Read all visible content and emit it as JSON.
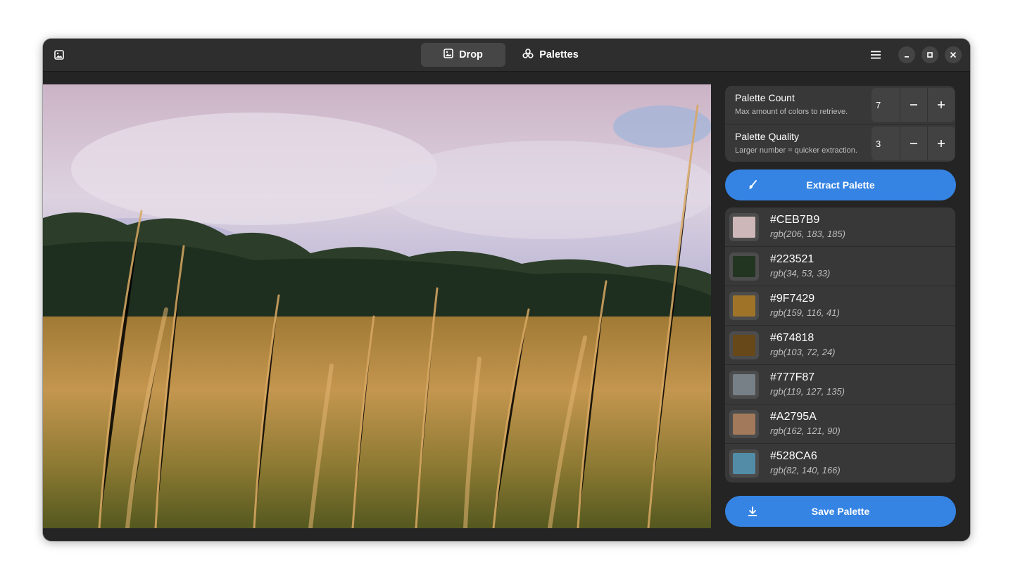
{
  "header": {
    "tabs": [
      {
        "label": "Drop",
        "icon": "image-icon",
        "active": true
      },
      {
        "label": "Palettes",
        "icon": "palette-icon",
        "active": false
      }
    ]
  },
  "settings": {
    "count": {
      "title": "Palette Count",
      "subtitle": "Max amount of colors to retrieve.",
      "value": "7"
    },
    "quality": {
      "title": "Palette Quality",
      "subtitle": "Larger number = quicker extraction.",
      "value": "3"
    }
  },
  "actions": {
    "extract_label": "Extract Palette",
    "save_label": "Save Palette"
  },
  "palette": [
    {
      "hex": "#CEB7B9",
      "rgb": "rgb(206, 183, 185)"
    },
    {
      "hex": "#223521",
      "rgb": "rgb(34, 53, 33)"
    },
    {
      "hex": "#9F7429",
      "rgb": "rgb(159, 116, 41)"
    },
    {
      "hex": "#674818",
      "rgb": "rgb(103, 72, 24)"
    },
    {
      "hex": "#777F87",
      "rgb": "rgb(119, 127, 135)"
    },
    {
      "hex": "#A2795A",
      "rgb": "rgb(162, 121, 90)"
    },
    {
      "hex": "#528CA6",
      "rgb": "rgb(82, 140, 166)"
    }
  ],
  "colors": {
    "accent": "#3584e4",
    "headerbar": "#2e2e2e",
    "card": "#383838"
  }
}
